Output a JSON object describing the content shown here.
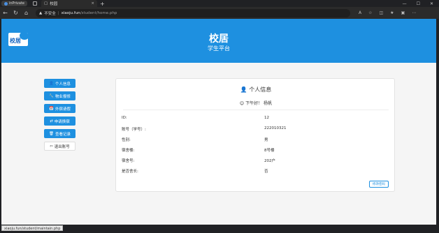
{
  "browser": {
    "workspace_label": "inPrivate",
    "tab_title": "校园",
    "tab_close": "×",
    "new_tab": "+",
    "window_controls": [
      "—",
      "☐",
      "✕"
    ],
    "security_label": "不安全",
    "url_host": "xiaoju.fun",
    "url_path": "/student/home.php"
  },
  "header": {
    "logo_text": "校居",
    "title": "校居",
    "subtitle": "学生平台"
  },
  "menu": {
    "items": [
      {
        "icon": "person-icon",
        "glyph": "👤",
        "label": "个人信息",
        "active": true
      },
      {
        "icon": "wrench-icon",
        "glyph": "🔧",
        "label": "物业报修",
        "active": true
      },
      {
        "icon": "calendar-icon",
        "glyph": "📅",
        "label": "外宿请假",
        "active": true
      },
      {
        "icon": "swap-icon",
        "glyph": "⇄",
        "label": "申请换宿",
        "active": true
      },
      {
        "icon": "trash-icon",
        "glyph": "🗑",
        "label": "查看记录",
        "active": true
      },
      {
        "icon": "logout-icon",
        "glyph": "⇦",
        "label": "退出账号",
        "active": false
      }
    ]
  },
  "profile": {
    "title": "个人信息",
    "greeting_icon": "😊",
    "greeting": "下午好！",
    "name": "杨帆",
    "rows": [
      {
        "key": "ID:",
        "value": "12"
      },
      {
        "key": "账号（学号）:",
        "value": "222010321"
      },
      {
        "key": "性别:",
        "value": "男"
      },
      {
        "key": "宿舍楼:",
        "value": "8号楼"
      },
      {
        "key": "宿舍号:",
        "value": "202户"
      },
      {
        "key": "是否舍长:",
        "value": "否"
      }
    ],
    "edit_button": "修改密码"
  },
  "statusbar": {
    "url": "xiaoju.fun/student/maintain.php"
  }
}
